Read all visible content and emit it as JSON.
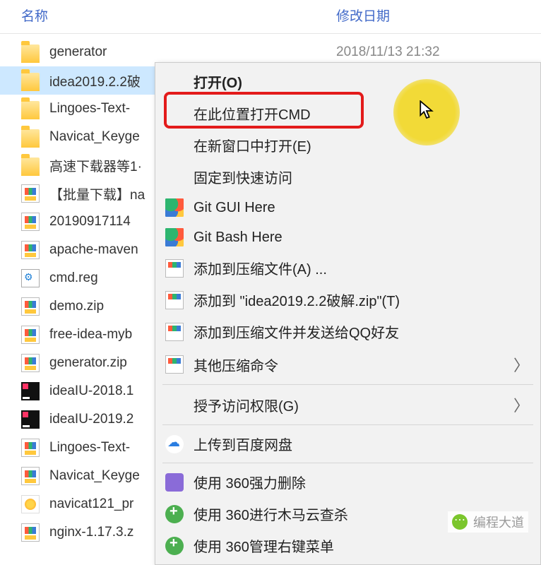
{
  "header": {
    "name": "名称",
    "date": "修改日期"
  },
  "files": [
    {
      "icon": "folder",
      "name": "generator",
      "date": "2018/11/13 21:32",
      "selected": false
    },
    {
      "icon": "folder",
      "name": "idea2019.2.2破",
      "date": "",
      "selected": true
    },
    {
      "icon": "folder",
      "name": "Lingoes-Text-",
      "date": "",
      "selected": false
    },
    {
      "icon": "folder",
      "name": "Navicat_Keyge",
      "date": "",
      "selected": false
    },
    {
      "icon": "folder",
      "name": "高速下载器等1·",
      "date": "",
      "selected": false
    },
    {
      "icon": "zip",
      "name": "【批量下载】na",
      "date": "",
      "selected": false
    },
    {
      "icon": "zip",
      "name": "20190917114",
      "date": "",
      "selected": false
    },
    {
      "icon": "zip",
      "name": "apache-maven",
      "date": "",
      "selected": false
    },
    {
      "icon": "reg",
      "name": "cmd.reg",
      "date": "",
      "selected": false
    },
    {
      "icon": "zip",
      "name": "demo.zip",
      "date": "",
      "selected": false
    },
    {
      "icon": "zip",
      "name": "free-idea-myb",
      "date": "",
      "selected": false
    },
    {
      "icon": "zip",
      "name": "generator.zip",
      "date": "",
      "selected": false
    },
    {
      "icon": "ij",
      "name": "ideaIU-2018.1",
      "date": "",
      "selected": false
    },
    {
      "icon": "ij",
      "name": "ideaIU-2019.2",
      "date": "",
      "selected": false
    },
    {
      "icon": "zip",
      "name": "Lingoes-Text-",
      "date": "",
      "selected": false
    },
    {
      "icon": "zip",
      "name": "Navicat_Keyge",
      "date": "",
      "selected": false
    },
    {
      "icon": "navicat",
      "name": "navicat121_pr",
      "date": "",
      "selected": false
    },
    {
      "icon": "zip",
      "name": "nginx-1.17.3.z",
      "date": "",
      "selected": false
    }
  ],
  "menu": {
    "open": "打开(O)",
    "open_cmd": "在此位置打开CMD",
    "new_window": "在新窗口中打开(E)",
    "pin_quick": "固定到快速访问",
    "git_gui": "Git GUI Here",
    "git_bash": "Git Bash Here",
    "add_archive": "添加到压缩文件(A) ...",
    "add_zip": "添加到 \"idea2019.2.2破解.zip\"(T)",
    "add_send_qq": "添加到压缩文件并发送给QQ好友",
    "other_compress": "其他压缩命令",
    "grant_access": "授予访问权限(G)",
    "baidu": "上传到百度网盘",
    "del360": "使用 360强力删除",
    "scan360": "使用 360进行木马云查杀",
    "menu360": "使用 360管理右键菜单"
  },
  "watermark": "编程大道"
}
